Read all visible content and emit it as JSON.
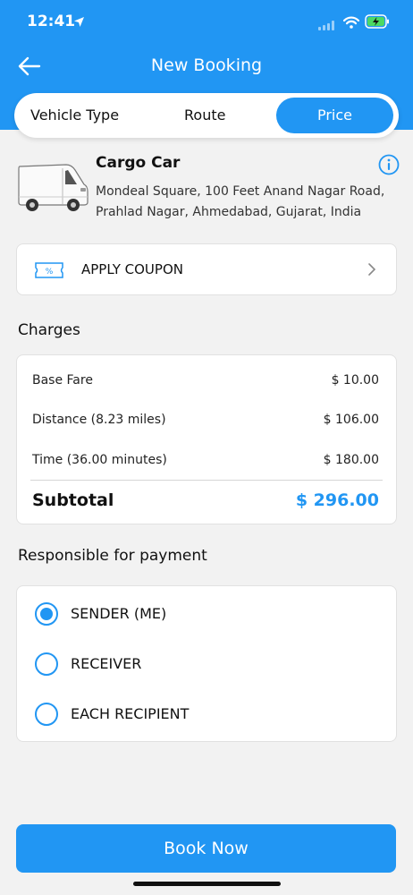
{
  "status_bar": {
    "time": "12:41"
  },
  "nav": {
    "title": "New Booking"
  },
  "tabs": [
    {
      "label": "Vehicle Type"
    },
    {
      "label": "Route"
    },
    {
      "label": "Price",
      "active": true
    }
  ],
  "vehicle": {
    "name": "Cargo Car",
    "address": "Mondeal Square, 100 Feet Anand Nagar Road, Prahlad Nagar, Ahmedabad, Gujarat, India"
  },
  "coupon": {
    "label": "APPLY COUPON",
    "icon": "coupon-ticket-icon"
  },
  "charges": {
    "title": "Charges",
    "rows": [
      {
        "label": "Base Fare",
        "value": "$ 10.00"
      },
      {
        "label": "Distance (8.23 miles)",
        "value": "$ 106.00"
      },
      {
        "label": "Time (36.00 minutes)",
        "value": "$ 180.00"
      }
    ],
    "subtotal": {
      "label": "Subtotal",
      "value": "$ 296.00"
    }
  },
  "payment": {
    "title": "Responsible for payment",
    "options": [
      {
        "label": "SENDER (ME)",
        "selected": true
      },
      {
        "label": "RECEIVER",
        "selected": false
      },
      {
        "label": "EACH RECIPIENT",
        "selected": false
      }
    ]
  },
  "actions": {
    "book_label": "Book Now"
  },
  "colors": {
    "accent": "#2196f3",
    "background": "#f2f2f2",
    "card": "#ffffff"
  }
}
